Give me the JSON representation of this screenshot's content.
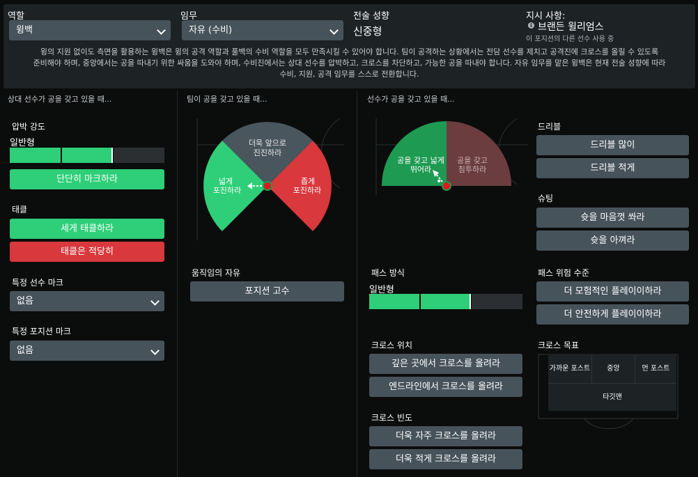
{
  "header": {
    "role_label": "역할",
    "role_value": "윙백",
    "duty_label": "임무",
    "duty_value": "자유 (수비)",
    "mentality_label": "전술 성향",
    "mentality_value": "신중형",
    "instructions_label": "지시 사항:",
    "player_name": "브랜든 윌리엄스",
    "player_note": "이 포지션의 다른 선수 사용 중",
    "description_lines": [
      "윙의 지원 없이도 측면을 활용하는 윙백은 윙의 공격 역할과 풀백의 수비 역할을 모두 만족시킬 수 있어야 합니다. 팀이 공격하는 상황에서는 전담 선수를 제치고 공격진에 크로스를 올릴 수 있도록",
      "준비해야 하며, 중앙에서는 공을 따내기 위한 싸움을 도와야 하며, 수비진에서는 상대 선수를 압박하고, 크로스를 차단하고, 가능한 공을 따내야 합니다. 자유 임무를 맡은 윙백은 현재 전술 성향에 따라",
      "수비, 지원, 공격 임무를 스스로 전환합니다."
    ]
  },
  "left": {
    "heading": "상대 선수가 공을 갖고 있을 때...",
    "pressing": {
      "label": "압박 강도",
      "value": "일반형",
      "level": 0.66,
      "button": "단단히 마크하라"
    },
    "tackling": {
      "label": "태클",
      "harder": "세게 태클하라",
      "ease_off": "태클은 적당히"
    },
    "mark_player": {
      "label": "특정 선수 마크",
      "value": "없음"
    },
    "mark_position": {
      "label": "특정 포지션 마크",
      "value": "없음"
    }
  },
  "middle": {
    "heading": "팀이 공을 갖고 있을 때...",
    "wedge_forward": [
      "더욱 앞으로",
      "진진하라"
    ],
    "wedge_wide": [
      "넓게",
      "포진하라"
    ],
    "wedge_narrow": [
      "좁게",
      "포진하라"
    ],
    "freedom_label": "움직임의 자유",
    "freedom_button": "포지션 고수"
  },
  "right": {
    "heading": "선수가 공을 갖고 있을 때...",
    "wedge_run_wide": [
      "공을 갖고 넓게",
      "뛰어라"
    ],
    "wedge_dribble_inside": [
      "공을 갖고",
      "침투하라"
    ],
    "passing": {
      "label": "패스 방식",
      "value": "일반형",
      "level": 0.66
    },
    "cross_from": {
      "label": "크로스 위치",
      "deep": "깊은 곳에서 크로스를 올려라",
      "byline": "엔드라인에서 크로스를 올려라"
    },
    "cross_freq": {
      "label": "크로스 빈도",
      "more": "더욱 자주 크로스를 올려라",
      "less": "더욱 적게 크로스를 올려라"
    },
    "dribbling": {
      "label": "드리블",
      "more": "드리블 많이",
      "less": "드리블 적게"
    },
    "shooting": {
      "label": "슈팅",
      "more": "슛을 마음껏 쏴라",
      "less": "슛을 아껴라"
    },
    "passing_risk": {
      "label": "패스 위험 수준",
      "risky": "더 모험적인 플레이이하라",
      "safer": "더 안전하게 플레이이하라"
    },
    "cross_target": {
      "label": "크로스 목표",
      "near": "가까운 포스트",
      "centre": "중앙",
      "far": "먼 포스트",
      "target": "타깃맨"
    }
  },
  "colors": {
    "green": "#2ecf78",
    "red": "#d9383c",
    "gray": "#47535b",
    "slate": "#4a565e",
    "dark_green": "#1e9a52",
    "maroon": "#6b3d3f"
  }
}
